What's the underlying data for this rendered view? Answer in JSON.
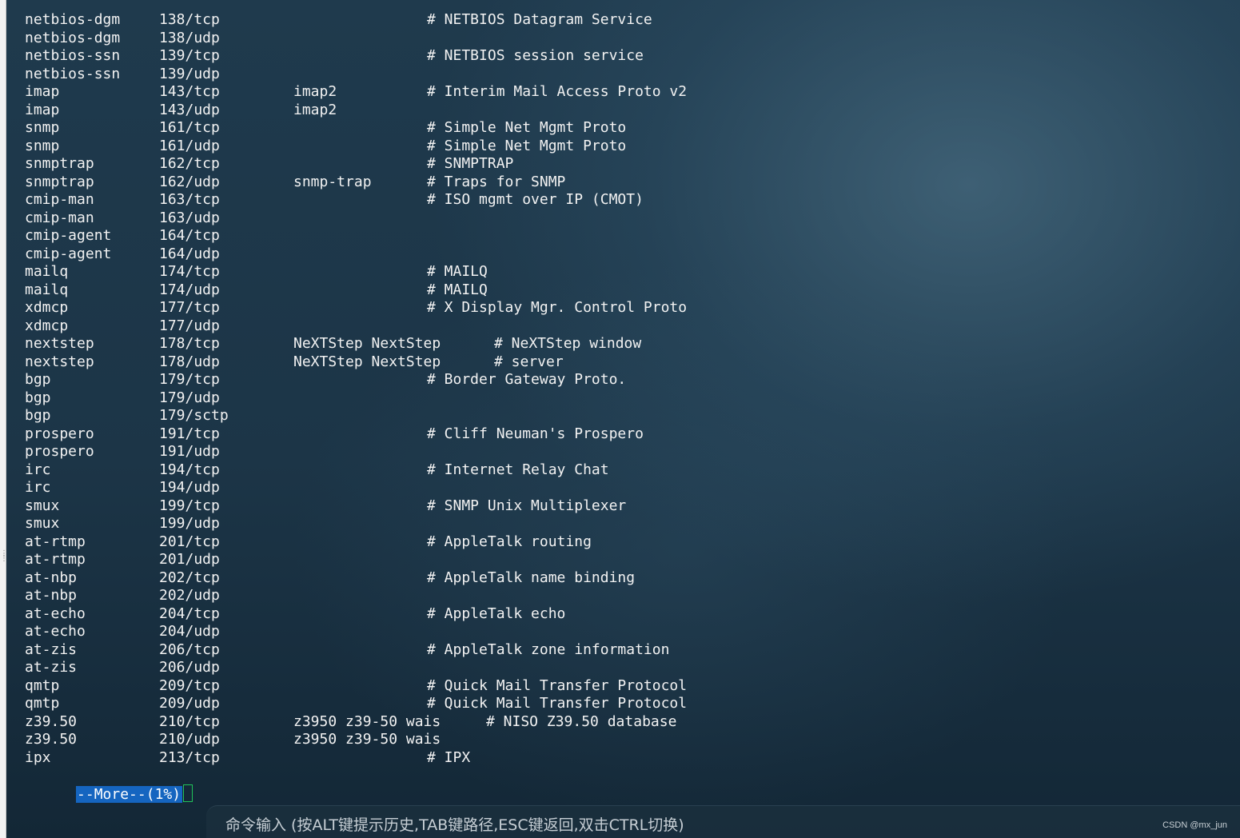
{
  "terminal": {
    "lines": [
      {
        "name": "netbios-dgm",
        "port": "138/tcp",
        "alias": "",
        "comment": "# NETBIOS Datagram Service"
      },
      {
        "name": "netbios-dgm",
        "port": "138/udp",
        "alias": "",
        "comment": ""
      },
      {
        "name": "netbios-ssn",
        "port": "139/tcp",
        "alias": "",
        "comment": "# NETBIOS session service"
      },
      {
        "name": "netbios-ssn",
        "port": "139/udp",
        "alias": "",
        "comment": ""
      },
      {
        "name": "imap",
        "port": "143/tcp",
        "alias": "imap2",
        "comment": "# Interim Mail Access Proto v2"
      },
      {
        "name": "imap",
        "port": "143/udp",
        "alias": "imap2",
        "comment": ""
      },
      {
        "name": "snmp",
        "port": "161/tcp",
        "alias": "",
        "comment": "# Simple Net Mgmt Proto"
      },
      {
        "name": "snmp",
        "port": "161/udp",
        "alias": "",
        "comment": "# Simple Net Mgmt Proto"
      },
      {
        "name": "snmptrap",
        "port": "162/tcp",
        "alias": "",
        "comment": "# SNMPTRAP"
      },
      {
        "name": "snmptrap",
        "port": "162/udp",
        "alias": "snmp-trap",
        "comment": "# Traps for SNMP"
      },
      {
        "name": "cmip-man",
        "port": "163/tcp",
        "alias": "",
        "comment": "# ISO mgmt over IP (CMOT)"
      },
      {
        "name": "cmip-man",
        "port": "163/udp",
        "alias": "",
        "comment": ""
      },
      {
        "name": "cmip-agent",
        "port": "164/tcp",
        "alias": "",
        "comment": ""
      },
      {
        "name": "cmip-agent",
        "port": "164/udp",
        "alias": "",
        "comment": ""
      },
      {
        "name": "mailq",
        "port": "174/tcp",
        "alias": "",
        "comment": "# MAILQ"
      },
      {
        "name": "mailq",
        "port": "174/udp",
        "alias": "",
        "comment": "# MAILQ"
      },
      {
        "name": "xdmcp",
        "port": "177/tcp",
        "alias": "",
        "comment": "# X Display Mgr. Control Proto"
      },
      {
        "name": "xdmcp",
        "port": "177/udp",
        "alias": "",
        "comment": ""
      },
      {
        "name": "nextstep",
        "port": "178/tcp",
        "alias": "NeXTStep NextStep",
        "comment_alt": "# NeXTStep window"
      },
      {
        "name": "nextstep",
        "port": "178/udp",
        "alias": "NeXTStep NextStep",
        "comment_alt": "# server"
      },
      {
        "name": "bgp",
        "port": "179/tcp",
        "alias": "",
        "comment": "# Border Gateway Proto."
      },
      {
        "name": "bgp",
        "port": "179/udp",
        "alias": "",
        "comment": ""
      },
      {
        "name": "bgp",
        "port": "179/sctp",
        "alias": "",
        "comment": ""
      },
      {
        "name": "prospero",
        "port": "191/tcp",
        "alias": "",
        "comment": "# Cliff Neuman's Prospero"
      },
      {
        "name": "prospero",
        "port": "191/udp",
        "alias": "",
        "comment": ""
      },
      {
        "name": "irc",
        "port": "194/tcp",
        "alias": "",
        "comment": "# Internet Relay Chat"
      },
      {
        "name": "irc",
        "port": "194/udp",
        "alias": "",
        "comment": ""
      },
      {
        "name": "smux",
        "port": "199/tcp",
        "alias": "",
        "comment": "# SNMP Unix Multiplexer"
      },
      {
        "name": "smux",
        "port": "199/udp",
        "alias": "",
        "comment": ""
      },
      {
        "name": "at-rtmp",
        "port": "201/tcp",
        "alias": "",
        "comment": "# AppleTalk routing"
      },
      {
        "name": "at-rtmp",
        "port": "201/udp",
        "alias": "",
        "comment": ""
      },
      {
        "name": "at-nbp",
        "port": "202/tcp",
        "alias": "",
        "comment": "# AppleTalk name binding"
      },
      {
        "name": "at-nbp",
        "port": "202/udp",
        "alias": "",
        "comment": ""
      },
      {
        "name": "at-echo",
        "port": "204/tcp",
        "alias": "",
        "comment": "# AppleTalk echo"
      },
      {
        "name": "at-echo",
        "port": "204/udp",
        "alias": "",
        "comment": ""
      },
      {
        "name": "at-zis",
        "port": "206/tcp",
        "alias": "",
        "comment": "# AppleTalk zone information"
      },
      {
        "name": "at-zis",
        "port": "206/udp",
        "alias": "",
        "comment": ""
      },
      {
        "name": "qmtp",
        "port": "209/tcp",
        "alias": "",
        "comment": "# Quick Mail Transfer Protocol"
      },
      {
        "name": "qmtp",
        "port": "209/udp",
        "alias": "",
        "comment": "# Quick Mail Transfer Protocol"
      },
      {
        "name": "z39.50",
        "port": "210/tcp",
        "alias": "z3950 z39-50 wais",
        "comment_z": "# NISO Z39.50 database"
      },
      {
        "name": "z39.50",
        "port": "210/udp",
        "alias": "z3950 z39-50 wais",
        "comment": ""
      },
      {
        "name": "ipx",
        "port": "213/tcp",
        "alias": "",
        "comment": "# IPX"
      }
    ],
    "more_prompt": "--More--(1%)"
  },
  "command_bar": {
    "placeholder": "命令输入 (按ALT键提示历史,TAB键路径,ESC键返回,双击CTRL切换)"
  },
  "watermark": "CSDN @mx_jun",
  "colors": {
    "terminal_text": "#f2f2f2",
    "more_highlight": "#1565c0",
    "cursor_border": "#21c45a"
  }
}
